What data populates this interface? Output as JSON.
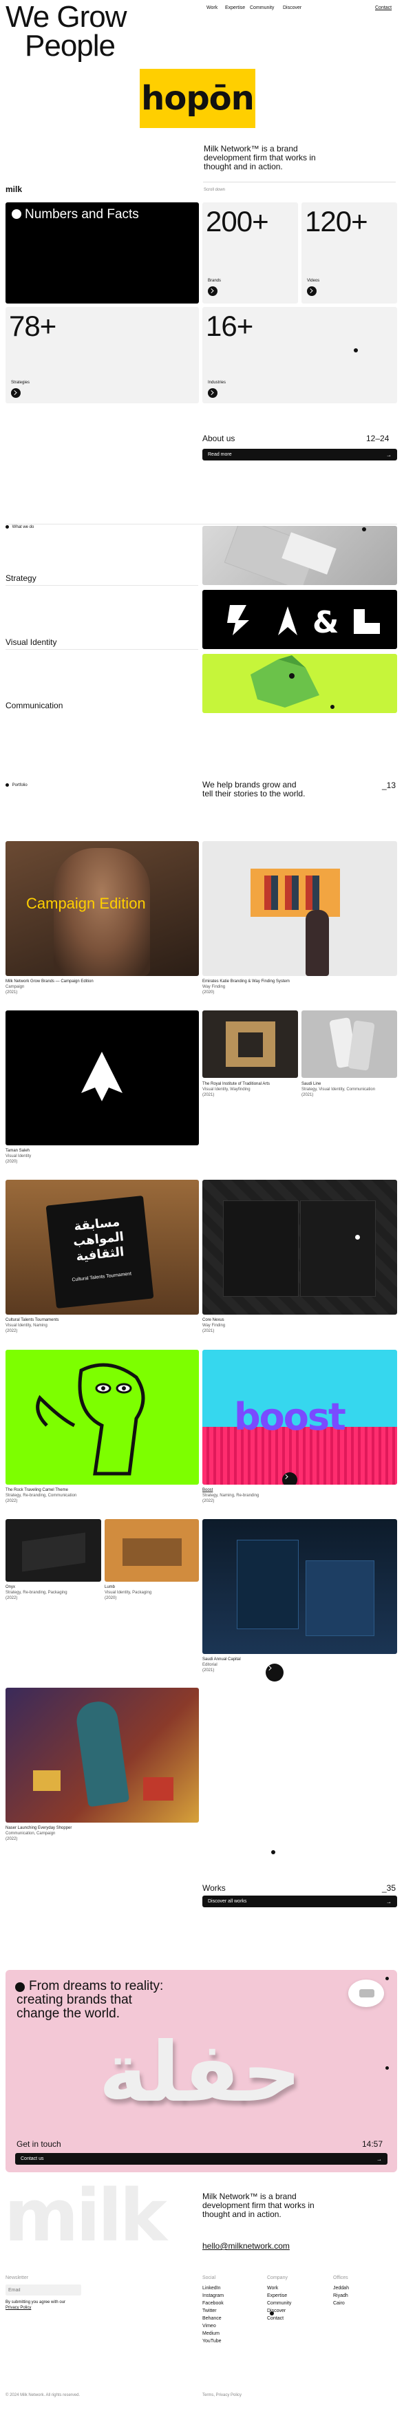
{
  "header": {
    "headline_line1": "We Grow",
    "headline_line2": "People",
    "nav": [
      "Work",
      "Expertise",
      "Community",
      "Discover"
    ],
    "contact": "Contact",
    "client_logo": "hopōn",
    "intro": "Milk Network™ is a brand development firm that works in thought and in action.",
    "scroll_hint": "Scroll down",
    "brand": "milk"
  },
  "facts": {
    "title": "Numbers and Facts",
    "items": [
      {
        "value": "200+",
        "label": "Brands"
      },
      {
        "value": "120+",
        "label": "Videos"
      },
      {
        "value": "78+",
        "label": "Strategies"
      },
      {
        "value": "16+",
        "label": "Industries"
      }
    ]
  },
  "about": {
    "title": "About us",
    "counter": "12–24",
    "button": "Read more"
  },
  "whatwedo": {
    "tag": "What we do",
    "items": [
      "Strategy",
      "Visual Identity",
      "Communication"
    ]
  },
  "portfolio": {
    "tag": "Portfolio",
    "heading": "We help brands grow and tell their stories to the world.",
    "counter": "_13",
    "campaign_overlay": "Campaign Edition",
    "arabic_title": "مسابقة المواهب الثقافية",
    "arabic_sub": "Cultural Talents Tournament",
    "boost": "boost",
    "projects": [
      {
        "title": "Milk Network Grow Brands — Campaign Edition",
        "tags": "Campaign",
        "year": "(2021)"
      },
      {
        "title": "Emirates Katie Branding & Way Finding System",
        "tags": "Way Finding",
        "year": "(2020)"
      },
      {
        "title": "Taman Saleh",
        "tags": "Visual Identity",
        "year": "(2020)"
      },
      {
        "title": "The Royal Institute of Traditional Arts",
        "tags": "Visual Identity, Wayfinding",
        "year": "(2021)"
      },
      {
        "title": "Saudi Line",
        "tags": "Strategy, Visual Identity, Communication",
        "year": "(2021)"
      },
      {
        "title": "Cultural Talents Tournaments",
        "tags": "Visual Identity, Naming",
        "year": "(2022)"
      },
      {
        "title": "Core Nexus",
        "tags": "Way Finding",
        "year": "(2021)"
      },
      {
        "title": "The Rock Traveling Camel Theme",
        "tags": "Strategy, Re-branding, Communication",
        "year": "(2022)"
      },
      {
        "title": "Boost",
        "tags": "Strategy, Naming, Re-branding",
        "year": "(2022)"
      },
      {
        "title": "Onyx",
        "tags": "Strategy, Re-branding, Packaging",
        "year": "(2022)"
      },
      {
        "title": "Lumb",
        "tags": "Visual Identity, Packaging",
        "year": "(2020)"
      },
      {
        "title": "Saudi Annual Capital",
        "tags": "Editorial",
        "year": "(2021)"
      },
      {
        "title": "Naser Launching Everyday Shopper",
        "tags": "Communication, Campaign",
        "year": "(2022)"
      }
    ]
  },
  "works": {
    "title": "Works",
    "counter": "_35",
    "button": "Discover all works"
  },
  "cta": {
    "heading": "From dreams to reality: creating brands that change the world.",
    "arabic": "حفلة",
    "label": "Get in touch",
    "counter": "14:57",
    "button": "Contact us"
  },
  "footer": {
    "wordmark": "milk",
    "statement": "Milk Network™ is a brand development firm that works in thought and in action.",
    "email": "hello@milknetwork.com",
    "newsletter_label": "Newsletter",
    "newsletter_placeholder": "Email",
    "newsletter_note": "By submitting you agree with our",
    "privacy_link": "Privacy Policy",
    "social_head": "Social",
    "social": [
      "LinkedIn",
      "Instagram",
      "Facebook",
      "Twitter",
      "Behance",
      "Vimeo",
      "Medium",
      "YouTube"
    ],
    "company_head": "Company",
    "company": [
      "Work",
      "Expertise",
      "Community",
      "Discover",
      "Contact"
    ],
    "offices_head": "Offices",
    "offices": [
      "Jeddah",
      "Riyadh",
      "Cairo"
    ],
    "copyright": "© 2024 Milk Network. All rights reserved.",
    "legal": "Terms, Privacy Policy"
  },
  "colors": {
    "accent_yellow": "#ffcf00",
    "lime": "#c6f53a",
    "camel_green": "#7dff00",
    "boost_cyan": "#36d7ee",
    "boost_pink": "#ff2d6f",
    "cta_pink": "#f3c8d6"
  }
}
